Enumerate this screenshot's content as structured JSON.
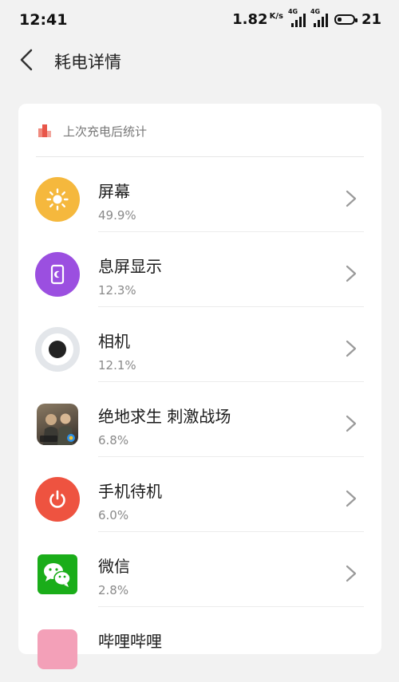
{
  "status_bar": {
    "time": "12:41",
    "speed_value": "1.82",
    "speed_unit": "K/s",
    "signal_tag_1": "4G",
    "signal_tag_2": "4G",
    "battery_level": "21"
  },
  "header": {
    "title": "耗电详情",
    "back_icon": "chevron-left-icon"
  },
  "section": {
    "title": "上次充电后统计",
    "icon": "battery-stats-icon",
    "icon_color": "#e8564a"
  },
  "items": [
    {
      "name": "屏幕",
      "percent": "49.9%",
      "icon": "sun-icon",
      "color": "#f5b83d"
    },
    {
      "name": "息屏显示",
      "percent": "12.3%",
      "icon": "aod-moon-icon",
      "color": "#9b4fe0"
    },
    {
      "name": "相机",
      "percent": "12.1%",
      "icon": "camera-lens-icon",
      "color": "#e3e6ea"
    },
    {
      "name": "绝地求生 刺激战场",
      "percent": "6.8%",
      "icon": "game-pubg-icon",
      "color": "#6b6257"
    },
    {
      "name": "手机待机",
      "percent": "6.0%",
      "icon": "power-icon",
      "color": "#ee5340"
    },
    {
      "name": "微信",
      "percent": "2.8%",
      "icon": "wechat-icon",
      "color": "#1aad19"
    },
    {
      "name": "哔哩哔哩",
      "percent": "",
      "icon": "bilibili-icon",
      "color": "#f3a0b8"
    }
  ]
}
